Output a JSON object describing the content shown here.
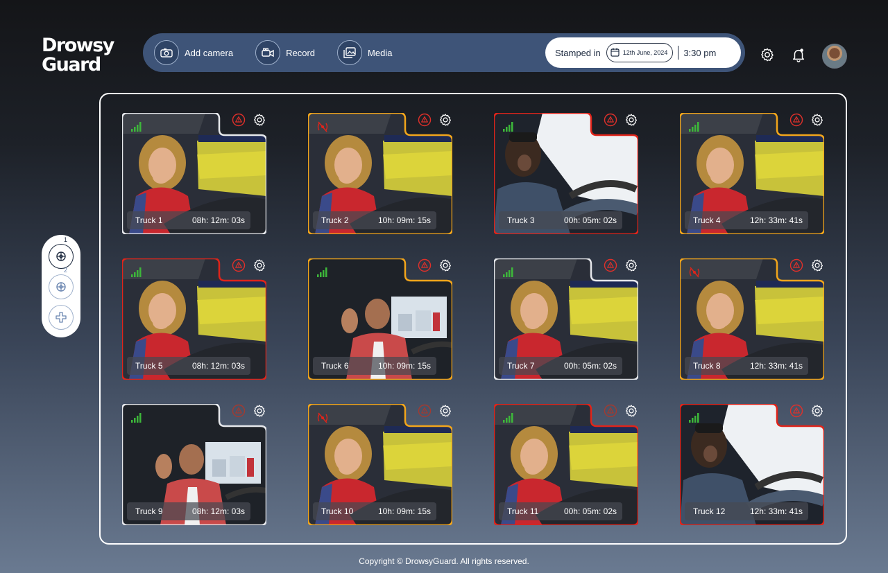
{
  "brand": {
    "line1": "Drowsy",
    "line2": "Guard"
  },
  "topbar": {
    "nav": [
      {
        "label": "Add camera",
        "icon": "camera-icon"
      },
      {
        "label": "Record",
        "icon": "video-camera-icon"
      },
      {
        "label": "Media",
        "icon": "media-gallery-icon"
      }
    ],
    "stamp_label": "Stamped in",
    "date": "12th June, 2024",
    "time": "3:30 pm"
  },
  "header_icons": [
    "gear-icon",
    "bell-icon",
    "avatar"
  ],
  "side_panel": {
    "buttons": [
      {
        "icon": "camera-grid-icon",
        "number": "1"
      },
      {
        "icon": "camera-grid-icon",
        "number": "2"
      },
      {
        "icon": "plus-icon",
        "number": ""
      }
    ]
  },
  "colors": {
    "ok": "#e6e8ec",
    "warning": "#f2a51b",
    "alert": "#e0241a",
    "signal_on": "#3db83a",
    "signal_off": "#e0241a",
    "accent": "#3e5478"
  },
  "cameras": [
    {
      "name": "Truck 1",
      "duration": "08h: 12m: 03s",
      "status": "ok",
      "signal": "on",
      "alert_muted": false,
      "scene": "woman"
    },
    {
      "name": "Truck 2",
      "duration": "10h: 09m: 15s",
      "status": "warning",
      "signal": "off",
      "alert_muted": false,
      "scene": "woman"
    },
    {
      "name": "Truck 3",
      "duration": "00h: 05m: 02s",
      "status": "alert",
      "signal": "on",
      "alert_muted": false,
      "scene": "yawn"
    },
    {
      "name": "Truck 4",
      "duration": "12h: 33m: 41s",
      "status": "warning",
      "signal": "on",
      "alert_muted": false,
      "scene": "woman"
    },
    {
      "name": "Truck 5",
      "duration": "08h: 12m: 03s",
      "status": "alert",
      "signal": "on",
      "alert_muted": false,
      "scene": "woman"
    },
    {
      "name": "Truck 6",
      "duration": "10h: 09m: 15s",
      "status": "warning",
      "signal": "on",
      "alert_muted": false,
      "scene": "wave"
    },
    {
      "name": "Truck 7",
      "duration": "00h: 05m: 02s",
      "status": "ok",
      "signal": "on",
      "alert_muted": false,
      "scene": "woman"
    },
    {
      "name": "Truck 8",
      "duration": "12h: 33m: 41s",
      "status": "warning",
      "signal": "off",
      "alert_muted": false,
      "scene": "woman"
    },
    {
      "name": "Truck 9",
      "duration": "08h: 12m: 03s",
      "status": "ok",
      "signal": "on",
      "alert_muted": true,
      "scene": "wave"
    },
    {
      "name": "Truck 10",
      "duration": "10h: 09m: 15s",
      "status": "warning",
      "signal": "off",
      "alert_muted": true,
      "scene": "woman"
    },
    {
      "name": "Truck 11",
      "duration": "00h: 05m: 02s",
      "status": "alert",
      "signal": "on",
      "alert_muted": true,
      "scene": "woman"
    },
    {
      "name": "Truck 12",
      "duration": "12h: 33m: 41s",
      "status": "alert",
      "signal": "on",
      "alert_muted": false,
      "scene": "yawn"
    }
  ],
  "footer": "Copyright © DrowsyGuard.  All rights reserved."
}
